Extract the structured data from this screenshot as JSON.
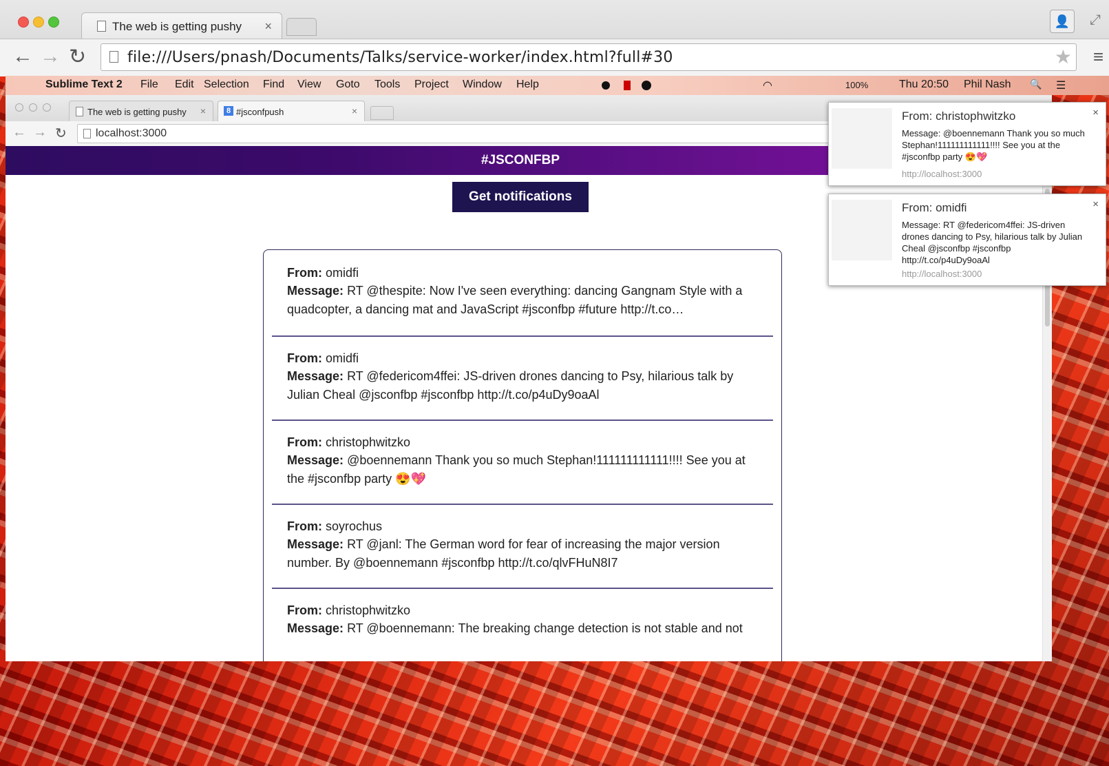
{
  "outer_browser": {
    "tab_title": "The web is getting pushy",
    "tab_close": "×",
    "url": "file:///Users/pnash/Documents/Talks/service-worker/index.html?full#30",
    "back": "←",
    "forward": "→",
    "reload": "↻",
    "star": "★",
    "menu": "≡",
    "person": "👤",
    "expand": "⤢"
  },
  "mac_menubar": {
    "apple": "",
    "app_name": "Sublime Text 2",
    "items": [
      "File",
      "Edit",
      "Selection",
      "Find",
      "View",
      "Goto",
      "Tools",
      "Project",
      "Window",
      "Help"
    ],
    "battery": "100%",
    "clock": "Thu 20:50",
    "user": "Phil Nash",
    "search": "🔍",
    "list": "☰"
  },
  "inner_browser": {
    "tabs": [
      {
        "title": "The web is getting pushy",
        "close": "×"
      },
      {
        "title": "#jsconfpush",
        "close": "×",
        "favicon": "8"
      }
    ],
    "url": "localhost:3000",
    "back": "←",
    "forward": "→",
    "reload": "↻"
  },
  "page": {
    "banner_title": "#JSCONFBP",
    "get_notifications_label": "Get notifications",
    "from_label": "From:",
    "message_label": "Message:",
    "messages": [
      {
        "from": "omidfi",
        "message": "RT @thespite: Now I've seen everything: dancing Gangnam Style with a quadcopter, a dancing mat and JavaScript #jsconfbp #future http://t.co…"
      },
      {
        "from": "omidfi",
        "message": "RT @federicom4ffei: JS-driven drones dancing to Psy, hilarious talk by Julian Cheal @jsconfbp #jsconfbp http://t.co/p4uDy9oaAl"
      },
      {
        "from": "christophwitzko",
        "message": "@boennemann Thank you so much Stephan!111111111111!!!! See you at the #jsconfbp party 😍💖"
      },
      {
        "from": "soyrochus",
        "message": "RT @janl: The German word for fear of increasing the major version number. By @boennemann #jsconfbp http://t.co/qlvFHuN8I7"
      },
      {
        "from": "christophwitzko",
        "message": "RT @boennemann: The breaking change detection is not stable and not"
      }
    ]
  },
  "notifications": [
    {
      "title": "From: christophwitzko",
      "message": "Message: @boennemann Thank you so much Stephan!111111111111!!!! See you at the #jsconfbp party 😍💖",
      "origin": "http://localhost:3000",
      "close": "×"
    },
    {
      "title": "From: omidfi",
      "message": "Message: RT @federicom4ffei: JS-driven drones dancing to Psy, hilarious talk by Julian Cheal @jsconfbp #jsconfbp http://t.co/p4uDy9oaAl",
      "origin": "http://localhost:3000",
      "close": "×"
    }
  ],
  "colors": {
    "banner_start": "#2e0c60",
    "banner_end": "#8a12a6",
    "button_bg": "#1d1450",
    "divider": "#5b5388"
  }
}
